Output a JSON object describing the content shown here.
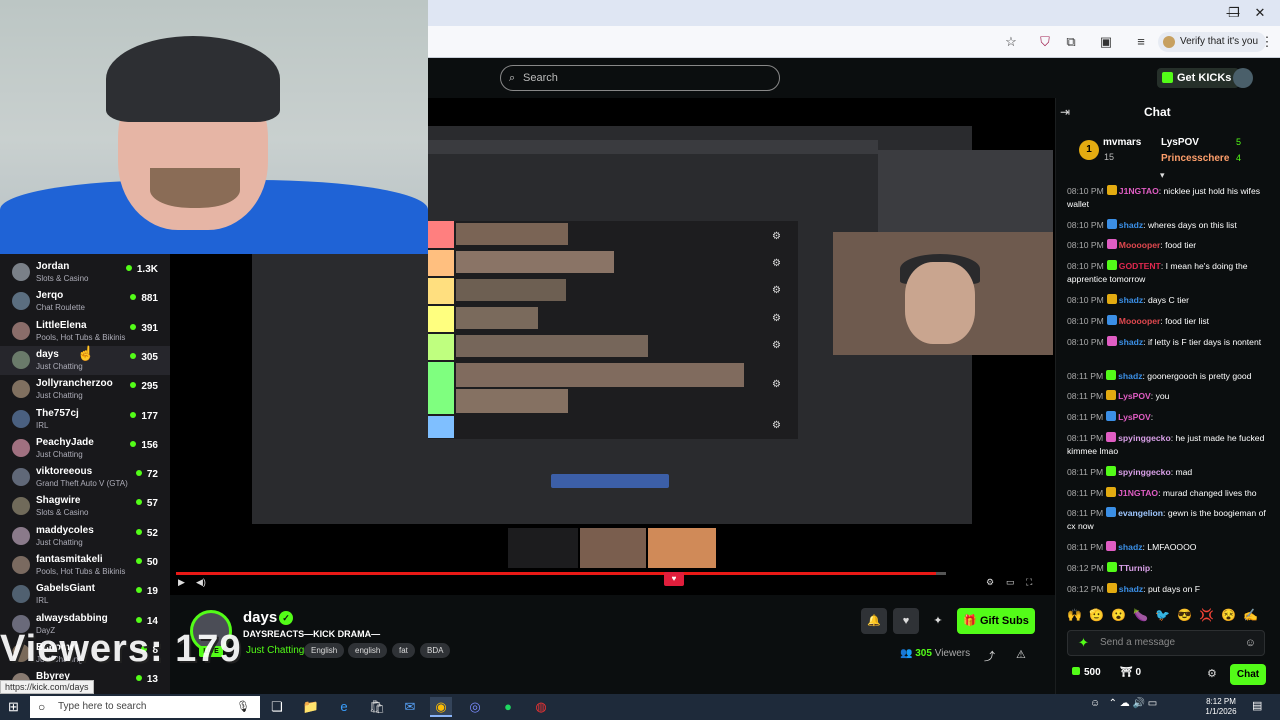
{
  "browser": {
    "window_controls": {
      "minimize": "—",
      "maximize": "❐",
      "close": "✕"
    },
    "toolbar_icons": [
      "star-icon",
      "shield-extension-icon",
      "puzzle-icon",
      "sidebar-icon",
      "media-icon"
    ],
    "verify_label": "Verify that it's you",
    "menu": "⋮"
  },
  "site": {
    "search_placeholder": "Search",
    "get_kicks": "Get KICKs"
  },
  "sidebar": {
    "channels": [
      {
        "name": "Jordan",
        "category": "Slots & Casino",
        "viewers": "1.3K"
      },
      {
        "name": "Jerqo",
        "category": "Chat Roulette",
        "viewers": "881"
      },
      {
        "name": "LittleElena",
        "category": "Pools, Hot Tubs & Bikinis",
        "viewers": "391"
      },
      {
        "name": "days",
        "category": "Just Chatting",
        "viewers": "305"
      },
      {
        "name": "Jollyrancherzoo",
        "category": "Just Chatting",
        "viewers": "295"
      },
      {
        "name": "The757cj",
        "category": "IRL",
        "viewers": "177"
      },
      {
        "name": "PeachyJade",
        "category": "Just Chatting",
        "viewers": "156"
      },
      {
        "name": "viktoreeous",
        "category": "Grand Theft Auto V (GTA)",
        "viewers": "72"
      },
      {
        "name": "Shagwire",
        "category": "Slots & Casino",
        "viewers": "57"
      },
      {
        "name": "maddycoles",
        "category": "Just Chatting",
        "viewers": "52"
      },
      {
        "name": "fantasmitakeli",
        "category": "Pools, Hot Tubs & Bikinis",
        "viewers": "50"
      },
      {
        "name": "GabelsGiant",
        "category": "IRL",
        "viewers": "19"
      },
      {
        "name": "alwaysdabbing",
        "category": "DayZ",
        "viewers": "14"
      },
      {
        "name": "Bshomer",
        "category": "Just Chatting",
        "viewers": "8"
      },
      {
        "name": "Bbyrey",
        "category": "Just Chatting",
        "viewers": "13"
      }
    ]
  },
  "overlay": {
    "viewers_text": "Viewers: 179",
    "status_url": "https://kick.com/days"
  },
  "stream": {
    "name": "days",
    "title": "DAYSREACTS—KICK DRAMA—",
    "category": "Just Chatting",
    "live": "LIVE",
    "tags": [
      "English",
      "english",
      "fat",
      "BDA"
    ],
    "viewer_count": "305",
    "viewers_label": "Viewers",
    "gift_subs": "Gift Subs",
    "progress": 0.987
  },
  "chat": {
    "title": "Chat",
    "leaderboard": [
      {
        "rank": "1",
        "name": "mvmars",
        "count": "15"
      },
      {
        "name": "LysPOV",
        "count": "5"
      },
      {
        "name": "Princesschere",
        "count": "4"
      }
    ],
    "messages": [
      {
        "time": "08:10 PM",
        "user": "J1NGTAO",
        "color": "#e05dc3",
        "text": "nicklee just hold his wifes wallet"
      },
      {
        "time": "08:10 PM",
        "user": "shadz",
        "color": "#3b8fe6",
        "text": "wheres days on this list"
      },
      {
        "time": "08:10 PM",
        "user": "Mooooper",
        "color": "#e0484f",
        "text": "food tier"
      },
      {
        "time": "08:10 PM",
        "user": "GODTENT",
        "color": "#e0284f",
        "text": "I mean he's doing the apprentice tomorrow"
      },
      {
        "time": "08:10 PM",
        "user": "shadz",
        "color": "#3b8fe6",
        "text": "days C tier"
      },
      {
        "time": "08:10 PM",
        "user": "Mooooper",
        "color": "#e0484f",
        "text": "food tier list"
      },
      {
        "time": "08:10 PM",
        "user": "shadz",
        "color": "#3b8fe6",
        "text": "if letty is F tier days is nontent"
      },
      {
        "time": "08:11 PM",
        "user": "shadz",
        "color": "#3b8fe6",
        "text": "goonergooch is pretty good"
      },
      {
        "time": "08:11 PM",
        "user": "LysPOV",
        "color": "#e05dc3",
        "text": "you"
      },
      {
        "time": "08:11 PM",
        "user": "LysPOV",
        "color": "#e05dc3",
        "text": ""
      },
      {
        "time": "08:11 PM",
        "user": "spyinggecko",
        "color": "#d9a0e8",
        "text": "he just made he fucked kimmee lmao"
      },
      {
        "time": "08:11 PM",
        "user": "spyinggecko",
        "color": "#d9a0e8",
        "text": "mad"
      },
      {
        "time": "08:11 PM",
        "user": "J1NGTAO",
        "color": "#e05dc3",
        "text": "murad changed lives tho"
      },
      {
        "time": "08:11 PM",
        "user": "evangelion",
        "color": "#9fc7ff",
        "text": "gewn is the boogieman of cx now"
      },
      {
        "time": "08:11 PM",
        "user": "shadz",
        "color": "#3b8fe6",
        "text": "LMFAOOOO"
      },
      {
        "time": "08:12 PM",
        "user": "TTurnip",
        "color": "#d9a0e8",
        "text": ""
      },
      {
        "time": "08:12 PM",
        "user": "shadz",
        "color": "#3b8fe6",
        "text": "put days on F"
      }
    ],
    "input_placeholder": "Send a message",
    "kicks_balance": "500",
    "rewards_count": "0",
    "chat_button": "Chat"
  },
  "taskbar": {
    "search_placeholder": "Type here to search",
    "time": "8:12 PM",
    "date": "1/1/2026"
  },
  "colors": {
    "kick_green": "#53fc18",
    "live_red": "#e91916",
    "taskbar": "#1e2a3a"
  }
}
